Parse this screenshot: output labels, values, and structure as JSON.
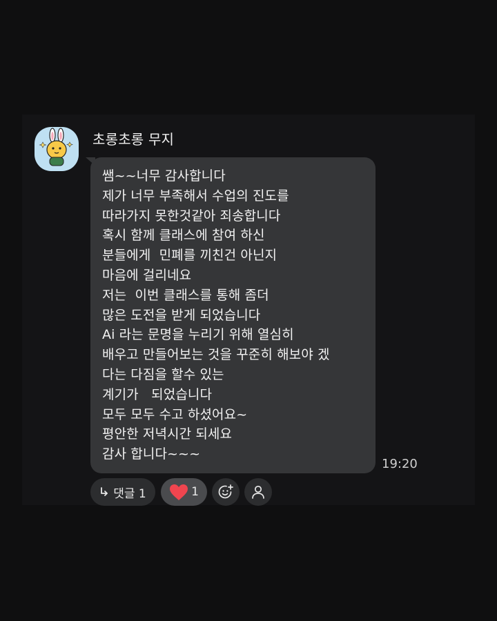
{
  "sender": {
    "name": "초롱초롱 무지"
  },
  "message": {
    "lines": [
      "쌤~~너무 감사합니다",
      "제가 너무 부족해서 수업의 진도를",
      "따라가지 못한것같아 죄송합니다",
      "혹시 함께 클래스에 참여 하신",
      "분들에게  민폐를 끼친건 아닌지",
      "마음에 걸리네요",
      "저는  이번 클래스를 통해 좀더",
      "많은 도전을 받게 되었습니다",
      "Ai 라는 문명을 누리기 위해 열심히",
      "배우고 만들어보는 것을 꾸준히 해보야 겠",
      "다는 다짐을 할수 있는",
      "계기가   되었습니다",
      "모두 모두 수고 하셨어요~",
      "평안한 저녁시간 되세요",
      "감사 합니다~~~"
    ],
    "time": "19:20"
  },
  "reactions": {
    "reply_label": "댓글 1",
    "like_count": "1",
    "icons": {
      "reply": "reply-arrow-icon",
      "like": "heart-icon",
      "emoji": "add-emoji-icon",
      "profile": "person-icon"
    }
  },
  "colors": {
    "background": "#0f0f10",
    "panel": "#141416",
    "bubble": "#353638",
    "heart": "#f0454f",
    "avatar_bg": "#bfe0f2"
  }
}
